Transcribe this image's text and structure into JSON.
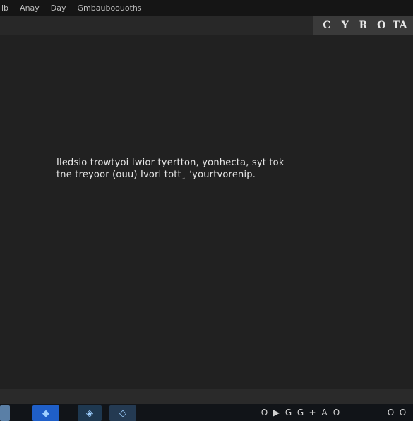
{
  "menu": {
    "items": [
      "ib",
      "Anay",
      "Day",
      "Gmbauboouoths"
    ]
  },
  "toolbar": {
    "buttons": [
      "C",
      "Y",
      "R",
      "O",
      "TA"
    ]
  },
  "editor": {
    "message_line1": "Iledsio trowtyoi Iwior tyertton, yonhecta, syt tok",
    "message_line2": "tne treyoor (ouu) Ivorl tott¸ ʻyourtvorenip."
  },
  "taskbar": {
    "controls": [
      "O",
      "▶",
      "G",
      "G",
      "+",
      "A",
      "O"
    ],
    "tray": [
      "O",
      "O"
    ]
  }
}
